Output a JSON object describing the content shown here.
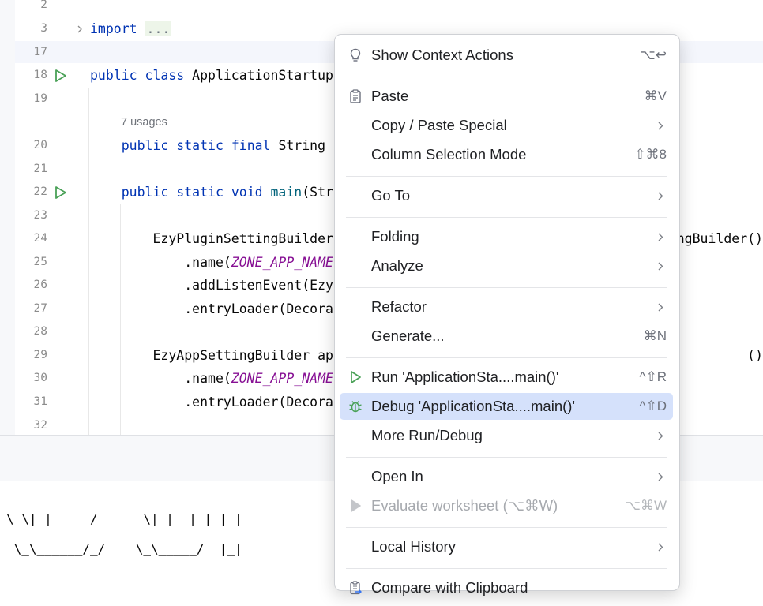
{
  "editor": {
    "lines": [
      {
        "num": "2",
        "code": []
      },
      {
        "num": "3",
        "fold": true,
        "code": [
          {
            "t": "import",
            "c": "kw"
          },
          {
            "t": " "
          },
          {
            "t": "...",
            "c": "folded"
          }
        ]
      },
      {
        "num": "17",
        "code": []
      },
      {
        "num": "18",
        "run": true,
        "code": [
          {
            "t": "public class ",
            "c": "kw"
          },
          {
            "t": "ApplicationStartup"
          }
        ]
      },
      {
        "num": "19",
        "code": []
      },
      {
        "num": "",
        "usages": "7 usages"
      },
      {
        "num": "20",
        "code": [
          {
            "t": "    "
          },
          {
            "t": "public static final ",
            "c": "kw"
          },
          {
            "t": "String"
          }
        ]
      },
      {
        "num": "21",
        "code": []
      },
      {
        "num": "22",
        "run": true,
        "code": [
          {
            "t": "    "
          },
          {
            "t": "public static void ",
            "c": "kw"
          },
          {
            "t": "main",
            "c": "fn"
          },
          {
            "t": "(Str"
          }
        ]
      },
      {
        "num": "23",
        "code": []
      },
      {
        "num": "24",
        "code": [
          {
            "t": "        EzyPluginSettingBuilder"
          }
        ],
        "tail": "ngBuilder()"
      },
      {
        "num": "25",
        "code": [
          {
            "t": "            .name("
          },
          {
            "t": "ZONE_APP_NAME",
            "c": "const"
          }
        ]
      },
      {
        "num": "26",
        "code": [
          {
            "t": "            .addListenEvent(Ezy"
          }
        ]
      },
      {
        "num": "27",
        "code": [
          {
            "t": "            .entryLoader(Decora"
          }
        ]
      },
      {
        "num": "28",
        "code": []
      },
      {
        "num": "29",
        "code": [
          {
            "t": "        EzyAppSettingBuilder ap"
          }
        ],
        "tail": "()"
      },
      {
        "num": "30",
        "code": [
          {
            "t": "            .name("
          },
          {
            "t": "ZONE_APP_NAME",
            "c": "const"
          }
        ]
      },
      {
        "num": "31",
        "code": [
          {
            "t": "            .entryLoader(Decora"
          }
        ]
      },
      {
        "num": "32",
        "code": []
      }
    ]
  },
  "console": {
    "lines": [
      "\\ \\| |____ / ____ \\| |__| | | |",
      " \\_\\______/_/    \\_\\_____/  |_|"
    ]
  },
  "context_menu": {
    "items": [
      {
        "label": "Show Context Actions",
        "shortcut": "⌥↩",
        "icon": "lightbulb-icon"
      },
      {
        "separator": true
      },
      {
        "label": "Paste",
        "shortcut": "⌘V",
        "icon": "clipboard-icon"
      },
      {
        "label": "Copy / Paste Special",
        "submenu": true
      },
      {
        "label": "Column Selection Mode",
        "shortcut": "⇧⌘8"
      },
      {
        "separator": true
      },
      {
        "label": "Go To",
        "submenu": true
      },
      {
        "separator": true
      },
      {
        "label": "Folding",
        "submenu": true
      },
      {
        "label": "Analyze",
        "submenu": true
      },
      {
        "separator": true
      },
      {
        "label": "Refactor",
        "submenu": true
      },
      {
        "label": "Generate...",
        "shortcut": "⌘N"
      },
      {
        "separator": true
      },
      {
        "label": "Run 'ApplicationSta....main()'",
        "shortcut": "^⇧R",
        "icon": "run-icon"
      },
      {
        "label": "Debug 'ApplicationSta....main()'",
        "shortcut": "^⇧D",
        "icon": "debug-icon",
        "selected": true
      },
      {
        "label": "More Run/Debug",
        "submenu": true
      },
      {
        "separator": true
      },
      {
        "label": "Open In",
        "submenu": true
      },
      {
        "label": "Evaluate worksheet (⌥⌘W)",
        "shortcut": "⌥⌘W",
        "icon": "run-icon",
        "disabled": true
      },
      {
        "separator": true
      },
      {
        "label": "Local History",
        "submenu": true
      },
      {
        "separator": true
      },
      {
        "label": "Compare with Clipboard",
        "icon": "compare-clipboard-icon"
      }
    ]
  },
  "colors": {
    "selection": "#d5e1fb",
    "keyword": "#0033b3",
    "method": "#00627a",
    "constant": "#871094",
    "run_green": "#4aa157"
  }
}
